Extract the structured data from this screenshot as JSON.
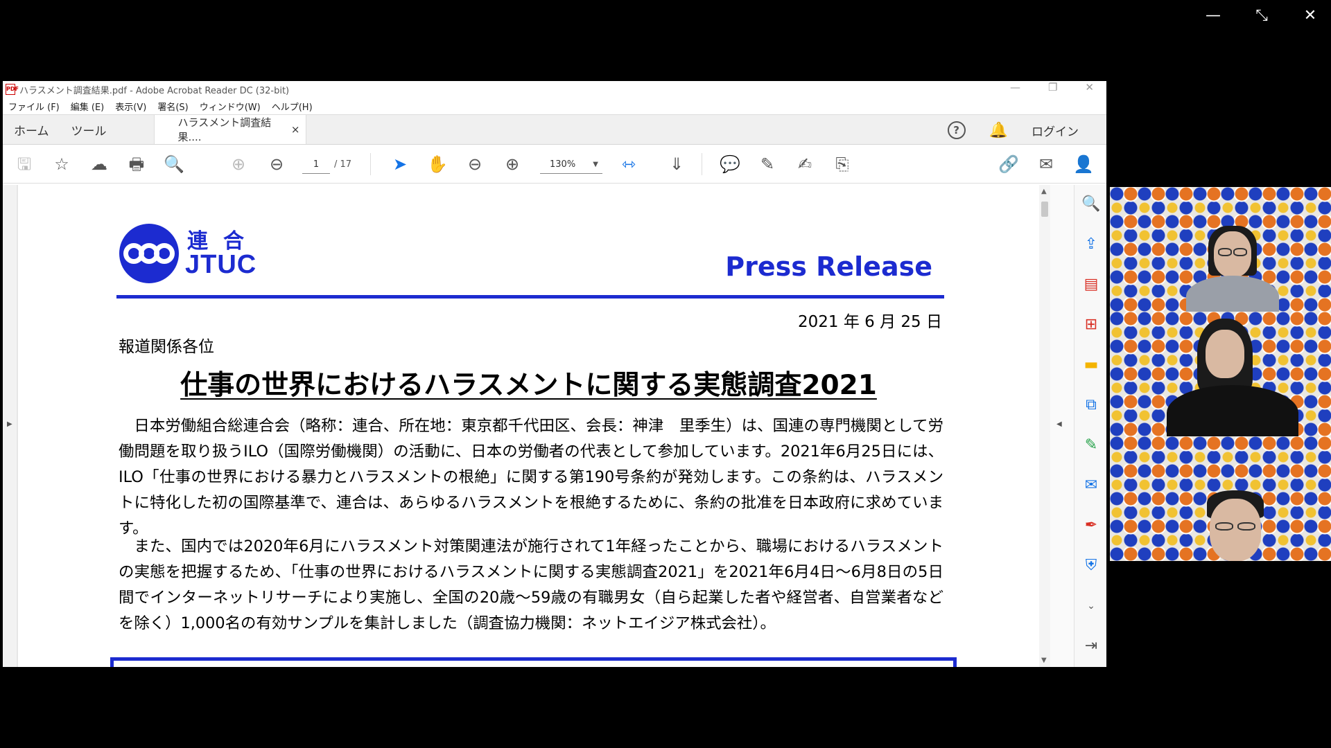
{
  "meeting_controls": {
    "minimize": "—",
    "exit_fullscreen": "⤡",
    "close": "✕"
  },
  "window": {
    "title": "ハラスメント調査結果.pdf - Adobe Acrobat Reader DC (32-bit)",
    "min": "—",
    "restore": "❐",
    "close": "✕"
  },
  "menu": [
    "ファイル (F)",
    "編集 (E)",
    "表示(V)",
    "署名(S)",
    "ウィンドウ(W)",
    "ヘルプ(H)"
  ],
  "tabs": {
    "home": "ホーム",
    "tools": "ツール",
    "document": "ハラスメント調査結果....",
    "close": "×",
    "help": "?",
    "login": "ログイン"
  },
  "toolbar": {
    "page_current": "1",
    "page_total": "/ 17",
    "zoom": "130%"
  },
  "document": {
    "logo_jp": "連合",
    "logo_en": "JTUC",
    "press_release": "Press Release",
    "date": "2021 年 6 月 25 日",
    "addressee": "報道関係各位",
    "headline": "仕事の世界におけるハラスメントに関する実態調査2021",
    "paragraph1": "日本労働組合総連合会（略称：連合、所在地：東京都千代田区、会長：神津　里季生）は、国連の専門機関として労働問題を取り扱うILO（国際労働機関）の活動に、日本の労働者の代表として参加しています。2021年6月25日には、ILO「仕事の世界における暴力とハラスメントの根絶」に関する第190号条約が発効します。この条約は、ハラスメントに特化した初の国際基準で、連合は、あらゆるハラスメントを根絶するために、条約の批准を日本政府に求めています。",
    "paragraph2": "また、国内では2020年6月にハラスメント対策関連法が施行されて1年経ったことから、職場におけるハラスメントの実態を把握するため、「仕事の世界におけるハラスメントに関する実態調査2021」を2021年6月4日～6月8日の5日間でインターネットリサーチにより実施し、全国の20歳～59歳の有職男女（自ら起業した者や経営者、自営業者などを除く）1,000名の有効サンプルを集計しました（調査協力機関：ネットエイジア株式会社）。"
  },
  "colors": {
    "brand_blue": "#1c2bd0",
    "acrobat_blue": "#1473e6",
    "acrobat_red": "#d93025"
  }
}
